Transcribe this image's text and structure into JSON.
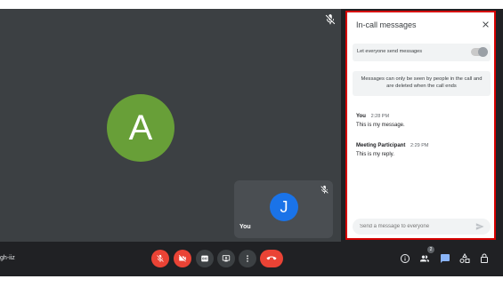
{
  "main": {
    "avatar_letter": "A",
    "self_avatar_letter": "J",
    "self_name": "You"
  },
  "panel": {
    "title": "In-call messages",
    "toggle_label": "Let everyone send messages",
    "notice": "Messages can only be seen by people in the call and are deleted when the call ends",
    "messages": [
      {
        "sender": "You",
        "time": "2:28 PM",
        "text": "This is my message."
      },
      {
        "sender": "Meeting Participant",
        "time": "2:29 PM",
        "text": "This is my reply."
      }
    ],
    "send_placeholder": "Send a message to everyone"
  },
  "bottom_bar": {
    "meeting_code": "gh-iiz",
    "participant_count": "2"
  },
  "colors": {
    "accent_red": "#ea4335",
    "avatar_green": "#689f38",
    "avatar_blue": "#1a73e8",
    "chat_blue": "#1a73e8"
  }
}
